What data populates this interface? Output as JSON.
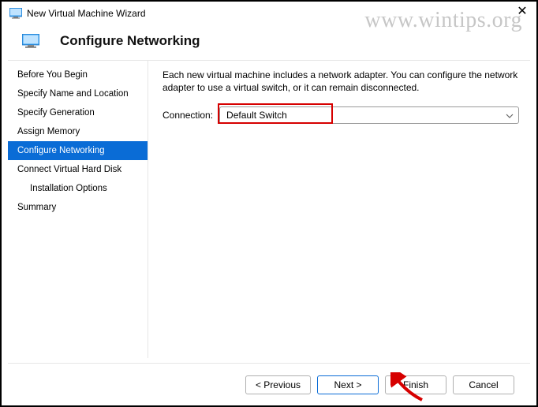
{
  "window": {
    "title": "New Virtual Machine Wizard"
  },
  "watermark": "www.wintips.org",
  "header": {
    "title": "Configure Networking"
  },
  "sidebar": {
    "items": [
      {
        "label": "Before You Begin",
        "selected": false,
        "indent": false
      },
      {
        "label": "Specify Name and Location",
        "selected": false,
        "indent": false
      },
      {
        "label": "Specify Generation",
        "selected": false,
        "indent": false
      },
      {
        "label": "Assign Memory",
        "selected": false,
        "indent": false
      },
      {
        "label": "Configure Networking",
        "selected": true,
        "indent": false
      },
      {
        "label": "Connect Virtual Hard Disk",
        "selected": false,
        "indent": false
      },
      {
        "label": "Installation Options",
        "selected": false,
        "indent": true
      },
      {
        "label": "Summary",
        "selected": false,
        "indent": false
      }
    ]
  },
  "main": {
    "description": "Each new virtual machine includes a network adapter. You can configure the network adapter to use a virtual switch, or it can remain disconnected.",
    "connection_label": "Connection:",
    "connection_value": "Default Switch"
  },
  "footer": {
    "previous": "< Previous",
    "next": "Next >",
    "finish": "Finish",
    "cancel": "Cancel"
  }
}
